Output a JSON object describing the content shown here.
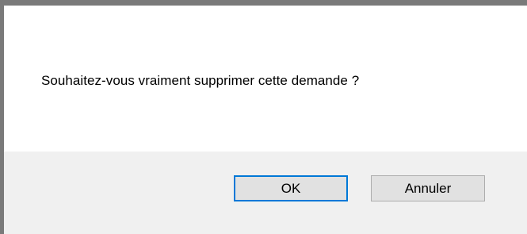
{
  "dialog": {
    "message": "Souhaitez-vous vraiment supprimer cette demande ?",
    "ok_label": "OK",
    "cancel_label": "Annuler",
    "accent_color": "#0078d7",
    "footer_color": "#f0f0f0"
  }
}
